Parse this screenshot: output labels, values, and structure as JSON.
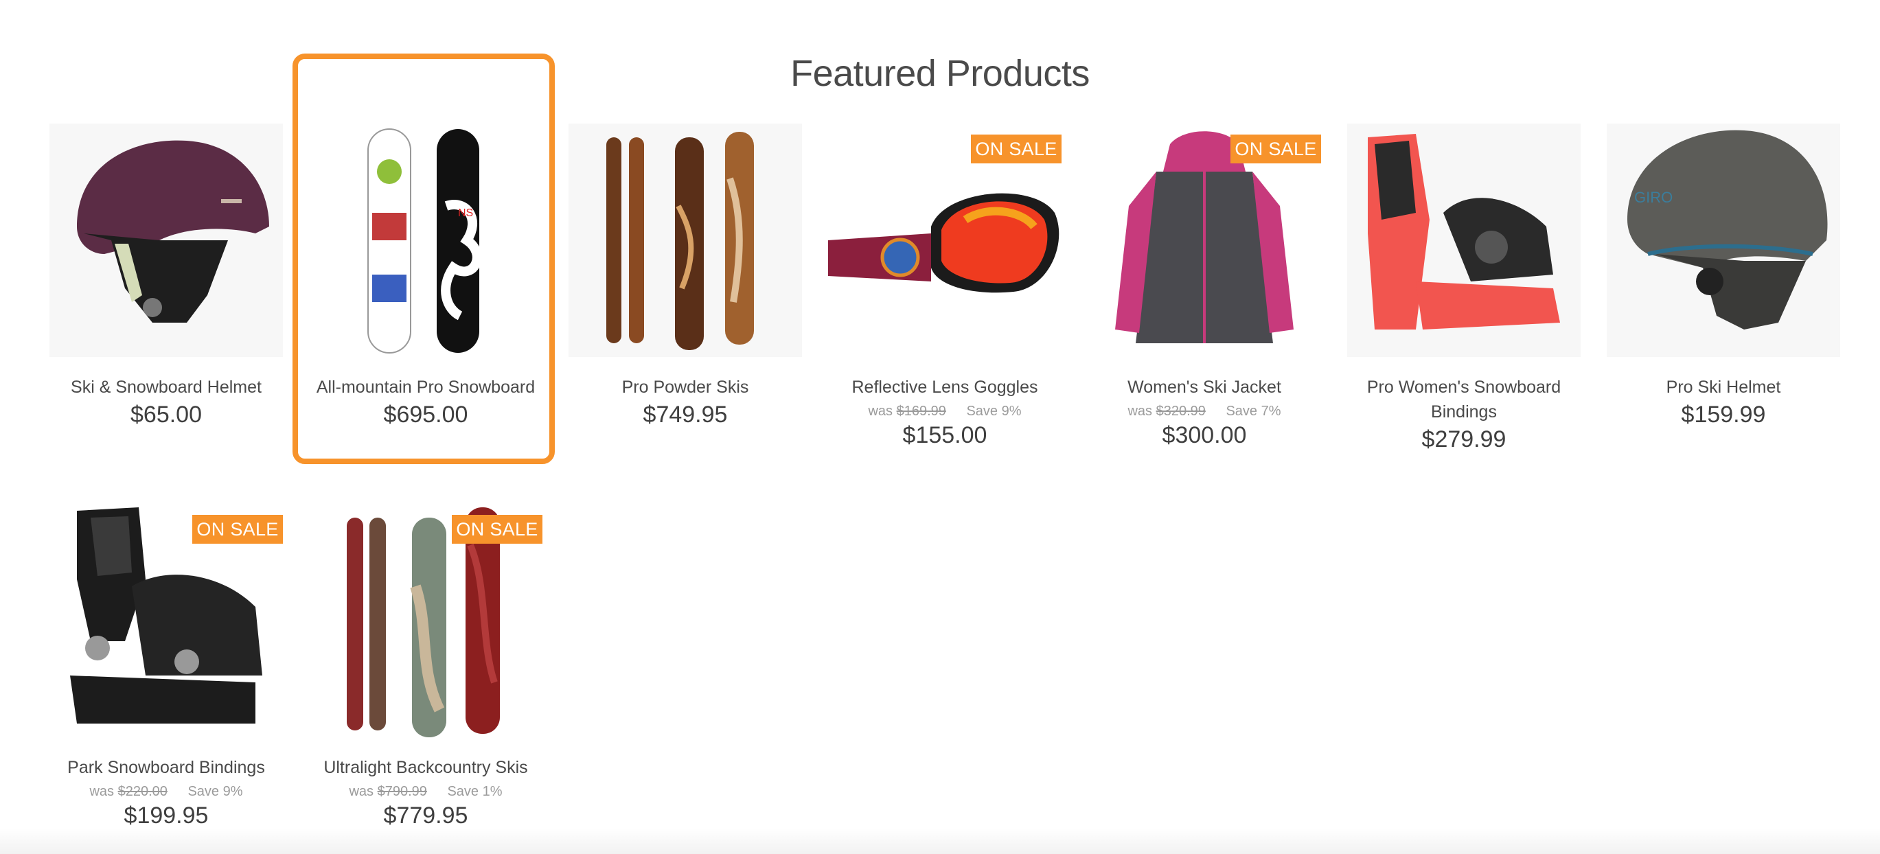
{
  "section": {
    "title": "Featured Products"
  },
  "colors": {
    "accent": "#f7932b",
    "text": "#4a4a4a",
    "muted": "#9b9b9b"
  },
  "products": [
    {
      "name": "Ski & Snowboard Helmet",
      "price": "$65.00",
      "on_sale": false,
      "badge": "",
      "was_label": "",
      "was_price": "",
      "save": "",
      "icon": "helmet-icon"
    },
    {
      "name": "All-mountain Pro Snowboard",
      "price": "$695.00",
      "on_sale": false,
      "badge": "",
      "was_label": "",
      "was_price": "",
      "save": "",
      "icon": "snowboard-icon",
      "highlighted": true
    },
    {
      "name": "Pro Powder Skis",
      "price": "$749.95",
      "on_sale": false,
      "badge": "",
      "was_label": "",
      "was_price": "",
      "save": "",
      "icon": "skis-icon"
    },
    {
      "name": "Reflective Lens Goggles",
      "price": "$155.00",
      "on_sale": true,
      "badge": "ON SALE",
      "was_label": "was",
      "was_price": "$169.99",
      "save": "Save 9%",
      "icon": "goggles-icon"
    },
    {
      "name": "Women's Ski Jacket",
      "price": "$300.00",
      "on_sale": true,
      "badge": "ON SALE",
      "was_label": "was",
      "was_price": "$320.99",
      "save": "Save 7%",
      "icon": "jacket-icon"
    },
    {
      "name": "Pro Women's Snowboard Bindings",
      "price": "$279.99",
      "on_sale": false,
      "badge": "",
      "was_label": "",
      "was_price": "",
      "save": "",
      "icon": "bindings-icon"
    },
    {
      "name": "Pro Ski Helmet",
      "price": "$159.99",
      "on_sale": false,
      "badge": "",
      "was_label": "",
      "was_price": "",
      "save": "",
      "icon": "helmet-icon"
    },
    {
      "name": "Park Snowboard Bindings",
      "price": "$199.95",
      "on_sale": true,
      "badge": "ON SALE",
      "was_label": "was",
      "was_price": "$220.00",
      "save": "Save 9%",
      "icon": "bindings-icon"
    },
    {
      "name": "Ultralight Backcountry Skis",
      "price": "$779.95",
      "on_sale": true,
      "badge": "ON SALE",
      "was_label": "was",
      "was_price": "$790.99",
      "save": "Save 1%",
      "icon": "skis-icon"
    }
  ]
}
